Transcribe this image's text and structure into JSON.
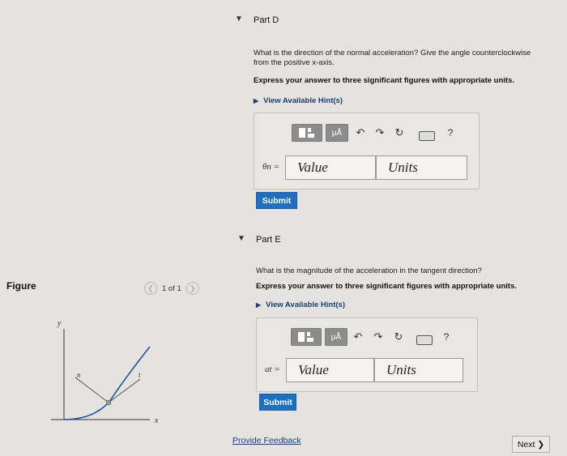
{
  "partD": {
    "toggle_icon": "triangle-down-icon",
    "title": "Part D",
    "question_line1": "What is the direction of the normal acceleration? Give the angle counterclockwise",
    "question_line2": "from the positive x-axis.",
    "instruction": "Express your answer to three significant figures with appropriate units.",
    "hint_label": "View Available Hint(s)",
    "variable": "θn =",
    "value_placeholder": "Value",
    "units_placeholder": "Units",
    "submit_label": "Submit",
    "help_label": "?"
  },
  "partE": {
    "toggle_icon": "triangle-down-icon",
    "title": "Part E",
    "question": "What is the magnitude of the acceleration in the tangent direction?",
    "instruction": "Express your answer to three significant figures with appropriate units.",
    "hint_label": "View Available Hint(s)",
    "variable": "at =",
    "value_placeholder": "Value",
    "units_placeholder": "Units",
    "submit_label": "Submit",
    "help_label": "?"
  },
  "figure": {
    "label": "Figure",
    "pager_text": "1 of 1",
    "axis_y": "y",
    "axis_x": "x",
    "label_n": "n",
    "label_t": "t"
  },
  "footer": {
    "feedback_label": "Provide Feedback",
    "next_label": "Next ❯"
  },
  "toolbar": {
    "mu_label": "μÅ"
  }
}
